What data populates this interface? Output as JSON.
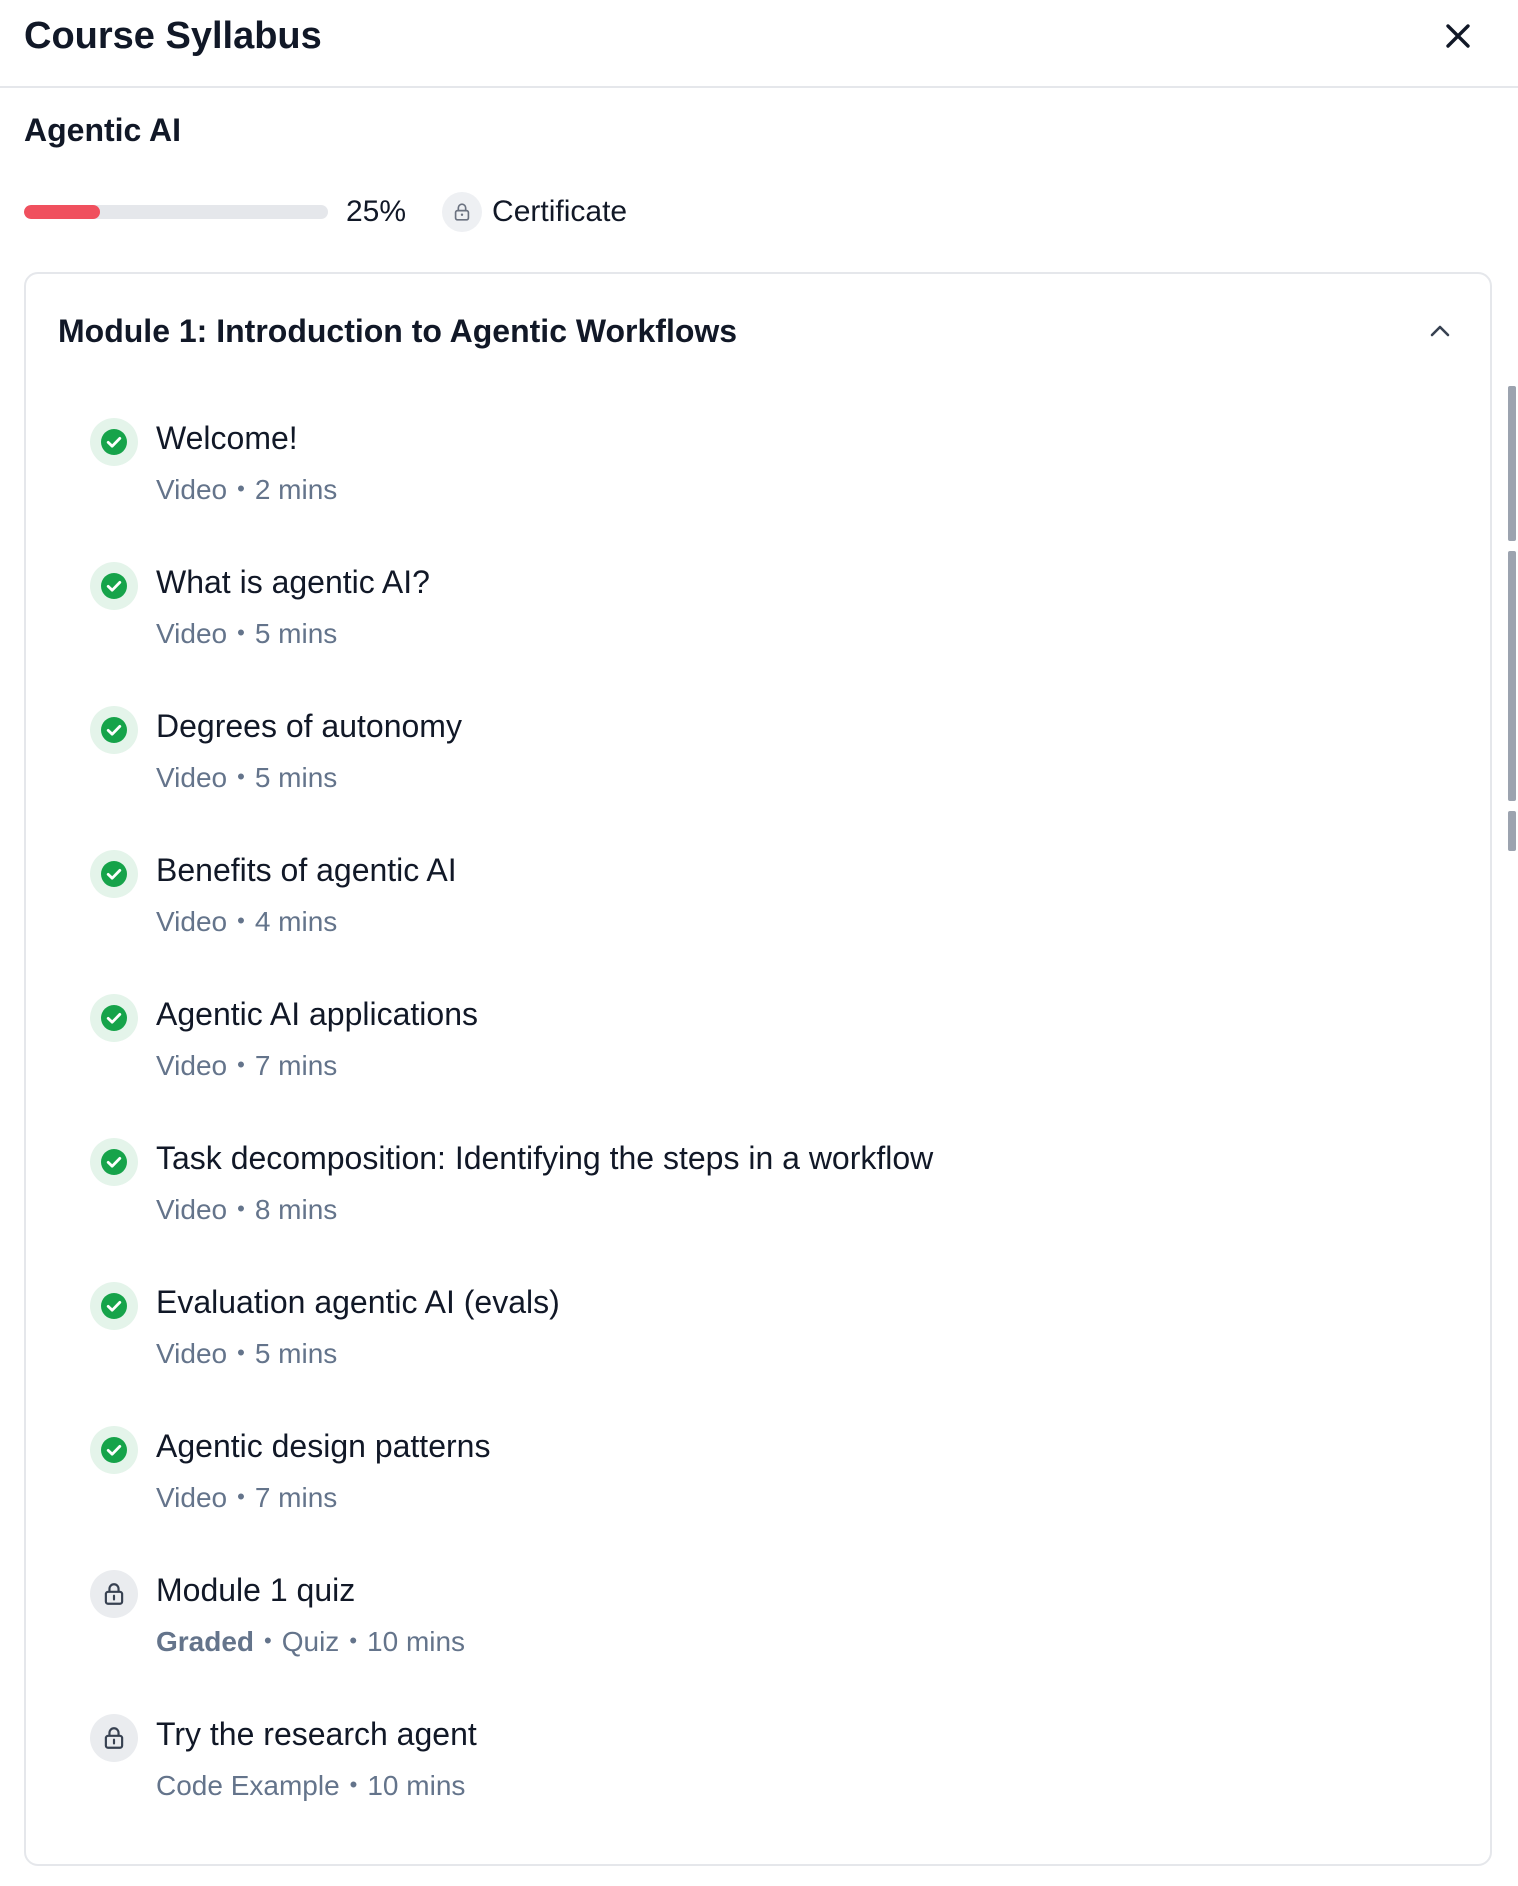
{
  "header": {
    "title": "Course Syllabus",
    "close_icon": "close-icon"
  },
  "course": {
    "name": "Agentic AI",
    "progress_percent": 25,
    "progress_label": "25%",
    "certificate_label": "Certificate",
    "certificate_icon": "lock-icon"
  },
  "module": {
    "title": "Module 1: Introduction to Agentic Workflows",
    "expanded": true,
    "lessons": [
      {
        "title": "Welcome!",
        "status": "completed",
        "graded": "",
        "type": "Video",
        "duration": "2 mins"
      },
      {
        "title": "What is agentic AI?",
        "status": "completed",
        "graded": "",
        "type": "Video",
        "duration": "5 mins"
      },
      {
        "title": "Degrees of autonomy",
        "status": "completed",
        "graded": "",
        "type": "Video",
        "duration": "5 mins"
      },
      {
        "title": "Benefits of agentic AI",
        "status": "completed",
        "graded": "",
        "type": "Video",
        "duration": "4 mins"
      },
      {
        "title": "Agentic AI applications",
        "status": "completed",
        "graded": "",
        "type": "Video",
        "duration": "7 mins"
      },
      {
        "title": "Task decomposition: Identifying the steps in a workflow",
        "status": "completed",
        "graded": "",
        "type": "Video",
        "duration": "8 mins"
      },
      {
        "title": "Evaluation agentic AI (evals)",
        "status": "completed",
        "graded": "",
        "type": "Video",
        "duration": "5 mins"
      },
      {
        "title": "Agentic design patterns",
        "status": "completed",
        "graded": "",
        "type": "Video",
        "duration": "7 mins"
      },
      {
        "title": "Module 1 quiz",
        "status": "locked",
        "graded": "Graded",
        "type": "Quiz",
        "duration": "10 mins"
      },
      {
        "title": "Try the research agent",
        "status": "locked",
        "graded": "",
        "type": "Code Example",
        "duration": "10 mins"
      }
    ]
  },
  "colors": {
    "progress_fill": "#f0505e",
    "check_green": "#16a34a",
    "meta_gray": "#64748b"
  }
}
